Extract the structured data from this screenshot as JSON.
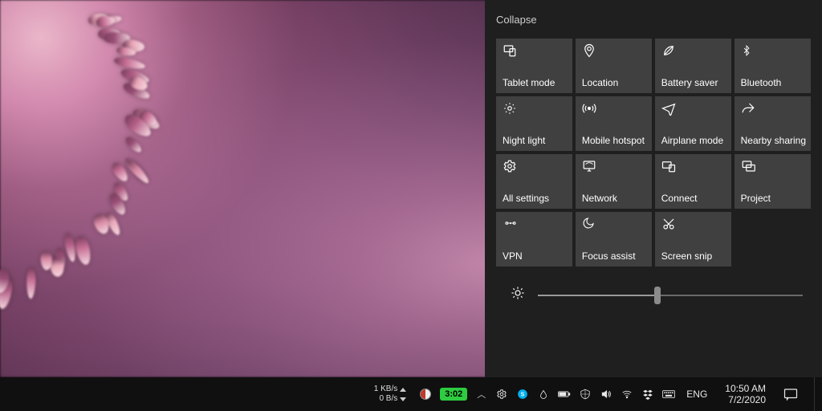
{
  "action_center": {
    "collapse_label": "Collapse",
    "tiles": [
      {
        "id": "tablet-mode",
        "label": "Tablet mode",
        "icon": "tablet"
      },
      {
        "id": "location",
        "label": "Location",
        "icon": "location"
      },
      {
        "id": "battery-saver",
        "label": "Battery saver",
        "icon": "leaf"
      },
      {
        "id": "bluetooth",
        "label": "Bluetooth",
        "icon": "bluetooth"
      },
      {
        "id": "night-light",
        "label": "Night light",
        "icon": "sun-dim"
      },
      {
        "id": "mobile-hotspot",
        "label": "Mobile hotspot",
        "icon": "hotspot"
      },
      {
        "id": "airplane-mode",
        "label": "Airplane mode",
        "icon": "airplane"
      },
      {
        "id": "nearby-sharing",
        "label": "Nearby sharing",
        "icon": "share"
      },
      {
        "id": "all-settings",
        "label": "All settings",
        "icon": "gear"
      },
      {
        "id": "network",
        "label": "Network",
        "icon": "network"
      },
      {
        "id": "connect",
        "label": "Connect",
        "icon": "connect"
      },
      {
        "id": "project",
        "label": "Project",
        "icon": "project"
      },
      {
        "id": "vpn",
        "label": "VPN",
        "icon": "vpn"
      },
      {
        "id": "focus-assist",
        "label": "Focus assist",
        "icon": "moon"
      },
      {
        "id": "screen-snip",
        "label": "Screen snip",
        "icon": "snip"
      }
    ],
    "brightness": {
      "value": 45,
      "min": 0,
      "max": 100
    }
  },
  "taskbar": {
    "net": {
      "up": "1 KB/s",
      "down": "0 B/s"
    },
    "green_clock": "3:02",
    "lang": "ENG",
    "time": "10:50 AM",
    "date": "7/2/2020"
  }
}
